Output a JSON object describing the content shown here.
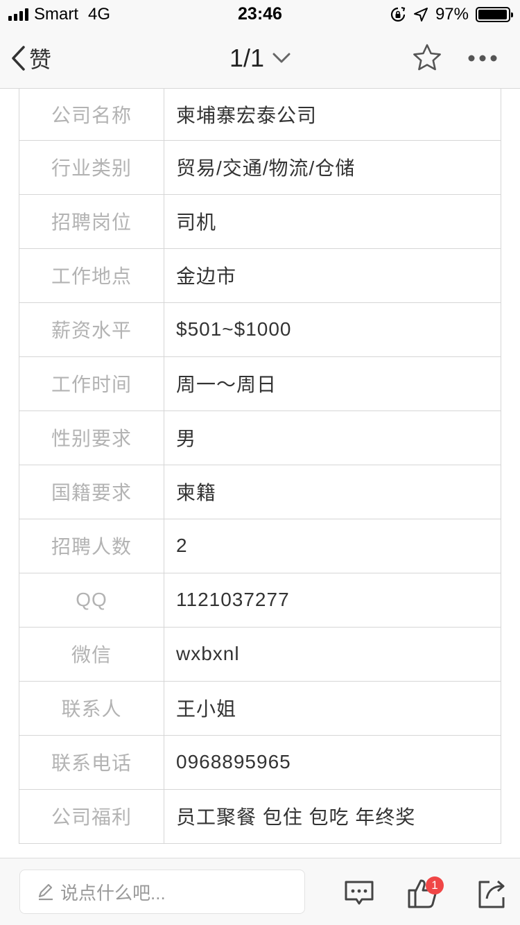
{
  "status_bar": {
    "carrier": "Smart",
    "network": "4G",
    "time": "23:46",
    "battery": "97%",
    "battery_level": 0.97
  },
  "nav": {
    "back_label": "赞",
    "title": "1/1",
    "icons": [
      "chevron-left-icon",
      "chevron-down-icon",
      "star-icon",
      "more-icon"
    ]
  },
  "rows": [
    {
      "label": "公司名称",
      "value": "柬埔寨宏泰公司"
    },
    {
      "label": "行业类别",
      "value": "贸易/交通/物流/仓储"
    },
    {
      "label": "招聘岗位",
      "value": "司机"
    },
    {
      "label": "工作地点",
      "value": "金边市"
    },
    {
      "label": "薪资水平",
      "value": "$501~$1000"
    },
    {
      "label": "工作时间",
      "value": "周一～周日"
    },
    {
      "label": "性别要求",
      "value": "男"
    },
    {
      "label": "国籍要求",
      "value": "柬籍"
    },
    {
      "label": "招聘人数",
      "value": "2"
    },
    {
      "label": "QQ",
      "value": "1121037277"
    },
    {
      "label": "微信",
      "value": "wxbxnl"
    },
    {
      "label": "联系人",
      "value": "王小姐"
    },
    {
      "label": "联系电话",
      "value": "0968895965"
    },
    {
      "label": "公司福利",
      "value": "员工聚餐 包住 包吃 年终奖"
    }
  ],
  "bottom_bar": {
    "comment_placeholder": "说点什么吧...",
    "like_count": "1",
    "icons": [
      "pencil-icon",
      "comment-icon",
      "thumbs-up-icon",
      "share-icon"
    ]
  }
}
